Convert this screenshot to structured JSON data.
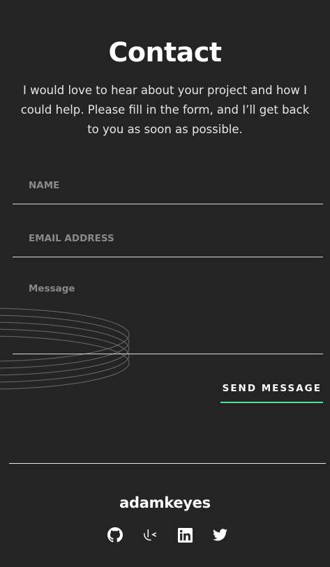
{
  "contact": {
    "title": "Contact",
    "intro": "I would love to hear about your project and how I could help. Please fill in the form, and I’ll get back to you as soon as possible."
  },
  "form": {
    "name_placeholder": "NAME",
    "email_placeholder": "EMAIL ADDRESS",
    "message_placeholder": "Message",
    "name_value": "",
    "email_value": "",
    "message_value": "",
    "send_label": "SEND MESSAGE"
  },
  "footer": {
    "name": "adamkeyes",
    "socials": [
      {
        "icon": "github-icon"
      },
      {
        "icon": "frontend-mentor-icon"
      },
      {
        "icon": "linkedin-icon"
      },
      {
        "icon": "twitter-icon"
      }
    ]
  },
  "colors": {
    "background": "#242424",
    "accent": "#4ee1a0",
    "text": "#ffffff",
    "placeholder": "#8a8a8a"
  }
}
